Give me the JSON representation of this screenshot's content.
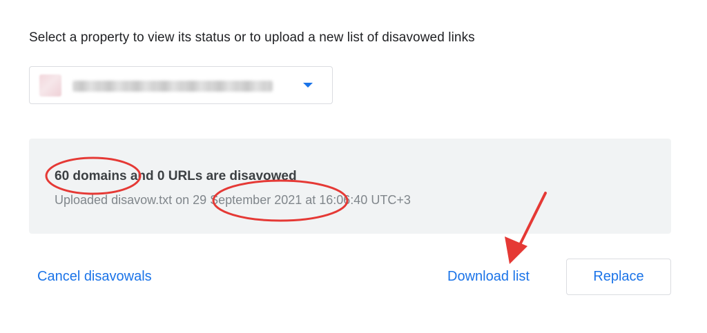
{
  "instruction": "Select a property to view its status or to upload a new list of disavowed links",
  "property_select": {
    "selected_value": "",
    "arrow_icon": "dropdown-arrow-icon"
  },
  "status": {
    "summary": "60 domains and 0 URLs are disavowed",
    "uploaded": "Uploaded disavow.txt on 29 September 2021 at 16:06:40 UTC+3"
  },
  "actions": {
    "cancel_label": "Cancel disavowals",
    "download_label": "Download list",
    "replace_label": "Replace"
  },
  "colors": {
    "accent": "#1a73e8",
    "annotation": "#e53935",
    "panel_bg": "#f1f3f4"
  }
}
